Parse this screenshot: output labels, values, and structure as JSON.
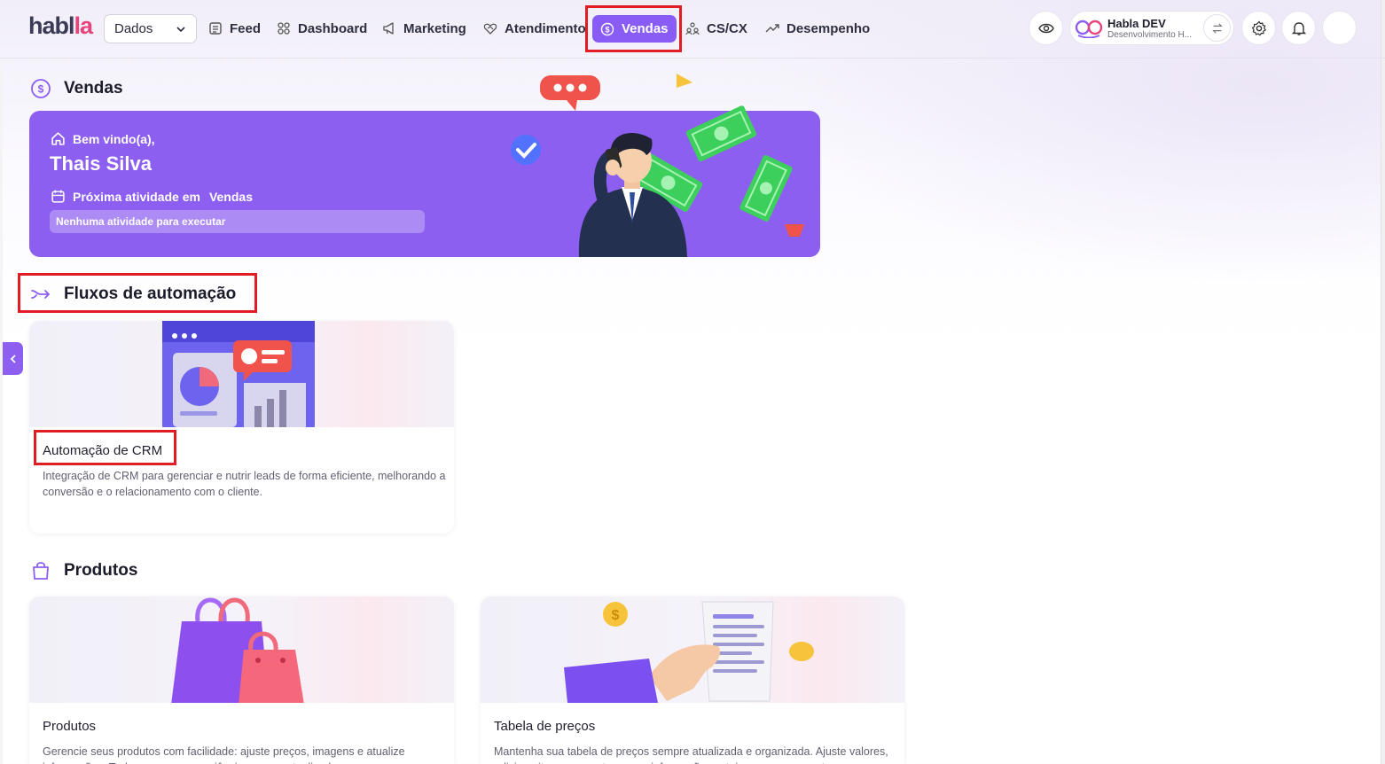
{
  "app": {
    "logo_main": "habl",
    "logo_accent": "la"
  },
  "topnav": {
    "workspace_selector": "Dados",
    "items": [
      {
        "label": "Feed",
        "icon": "feed-icon"
      },
      {
        "label": "Dashboard",
        "icon": "grid-icon"
      },
      {
        "label": "Marketing",
        "icon": "megaphone-icon"
      },
      {
        "label": "Atendimento",
        "icon": "heart-handshake-icon"
      },
      {
        "label": "Vendas",
        "icon": "dollar-circle-icon",
        "active": true
      },
      {
        "label": "CS/CX",
        "icon": "people-group-icon"
      },
      {
        "label": "Desempenho",
        "icon": "trend-up-icon"
      }
    ],
    "account": {
      "name": "Habla DEV",
      "subtitle": "Desenvolvimento H..."
    }
  },
  "vendas": {
    "title": "Vendas",
    "banner": {
      "welcome": "Bem vindo(a),",
      "user_name": "Thais Silva",
      "next_activity_prefix": "Próxima atividade em",
      "next_activity_module": "Vendas",
      "no_activity": "Nenhuma atividade para executar"
    }
  },
  "automation": {
    "title": "Fluxos de automação",
    "cards": [
      {
        "title": "Automação de CRM",
        "description": "Integração de CRM para gerenciar e nutrir leads de forma eficiente, melhorando a conversão e o relacionamento com o cliente."
      }
    ]
  },
  "products": {
    "title": "Produtos",
    "cards": [
      {
        "title": "Produtos",
        "description": "Gerencie seus produtos com facilidade: ajuste preços, imagens e atualize informações. Tudo para uma experiência sempre atualizada."
      },
      {
        "title": "Tabela de preços",
        "description": "Mantenha sua tabela de preços sempre atualizada e organizada. Ajuste valores, adicione itens e garanta que as informações estejam sempre corretas."
      }
    ]
  },
  "colors": {
    "primary": "#8d5ff0",
    "highlight": "#e01d24",
    "brand_accent": "#e8437a"
  }
}
